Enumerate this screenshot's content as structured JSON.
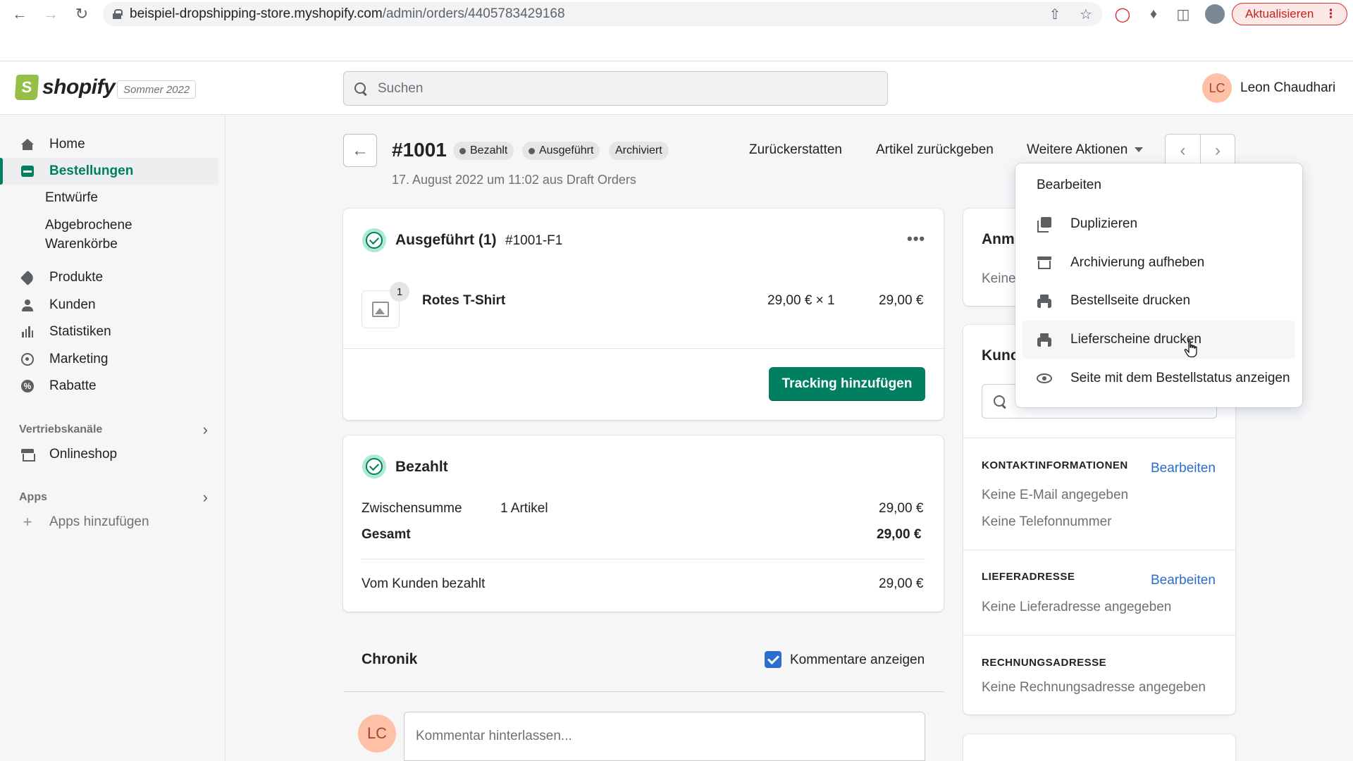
{
  "browser": {
    "url_host": "beispiel-dropshipping-store.myshopify.com",
    "url_path": "/admin/orders/4405783429168",
    "update_label": "Aktualisieren"
  },
  "topbar": {
    "logo_text": "shopify",
    "edition": "Sommer 2022",
    "search_placeholder": "Suchen",
    "user_initials": "LC",
    "user_name": "Leon Chaudhari"
  },
  "sidebar": {
    "home": "Home",
    "orders": "Bestellungen",
    "drafts": "Entwürfe",
    "abandoned_1": "Abgebrochene",
    "abandoned_2": "Warenkörbe",
    "products": "Produkte",
    "customers": "Kunden",
    "analytics": "Statistiken",
    "marketing": "Marketing",
    "discounts": "Rabatte",
    "sales_channels": "Vertriebskanäle",
    "online_store": "Onlineshop",
    "apps": "Apps",
    "add_apps": "Apps hinzufügen"
  },
  "order": {
    "number": "#1001",
    "badge_paid": "Bezahlt",
    "badge_fulfilled": "Ausgeführt",
    "badge_archived": "Archiviert",
    "subtitle": "17. August 2022 um 11:02 aus Draft Orders",
    "action_refund": "Zurückerstatten",
    "action_return": "Artikel zurückgeben",
    "action_more": "Weitere Aktionen"
  },
  "fulfillment": {
    "title": "Ausgeführt (1)",
    "id": "#1001-F1",
    "qty": "1",
    "item_name": "Rotes T-Shirt",
    "item_price": "29,00 € × 1",
    "item_total": "29,00 €",
    "tracking_button": "Tracking hinzufügen"
  },
  "payment": {
    "title": "Bezahlt",
    "subtotal_label": "Zwischensumme",
    "subtotal_items": "1 Artikel",
    "subtotal_value": "29,00 €",
    "total_label": "Gesamt",
    "total_value": "29,00 €",
    "paid_label": "Vom Kunden bezahlt",
    "paid_value": "29,00 €"
  },
  "timeline": {
    "title": "Chronik",
    "show_comments": "Kommentare anzeigen",
    "avatar": "LC",
    "comment_placeholder": "Kommentar hinterlassen..."
  },
  "right": {
    "notes_title": "Anm",
    "notes_text": "Keine",
    "customer_title": "Kunc",
    "contact_label": "KONTAKTINFORMATIONEN",
    "edit": "Bearbeiten",
    "no_email": "Keine E-Mail angegeben",
    "no_phone": "Keine Telefonnummer",
    "shipping_label": "LIEFERADRESSE",
    "no_shipping": "Keine Lieferadresse angegeben",
    "billing_label": "RECHNUNGSADRESSE",
    "no_billing": "Keine Rechnungsadresse angegeben"
  },
  "dropdown": {
    "edit": "Bearbeiten",
    "duplicate": "Duplizieren",
    "unarchive": "Archivierung aufheben",
    "print_order": "Bestellseite drucken",
    "print_packing": "Lieferscheine drucken",
    "view_status": "Seite mit dem Bestellstatus anzeigen"
  },
  "colors": {
    "primary": "#008060",
    "link": "#2c6ecb",
    "success_bg": "#aee9d1"
  }
}
